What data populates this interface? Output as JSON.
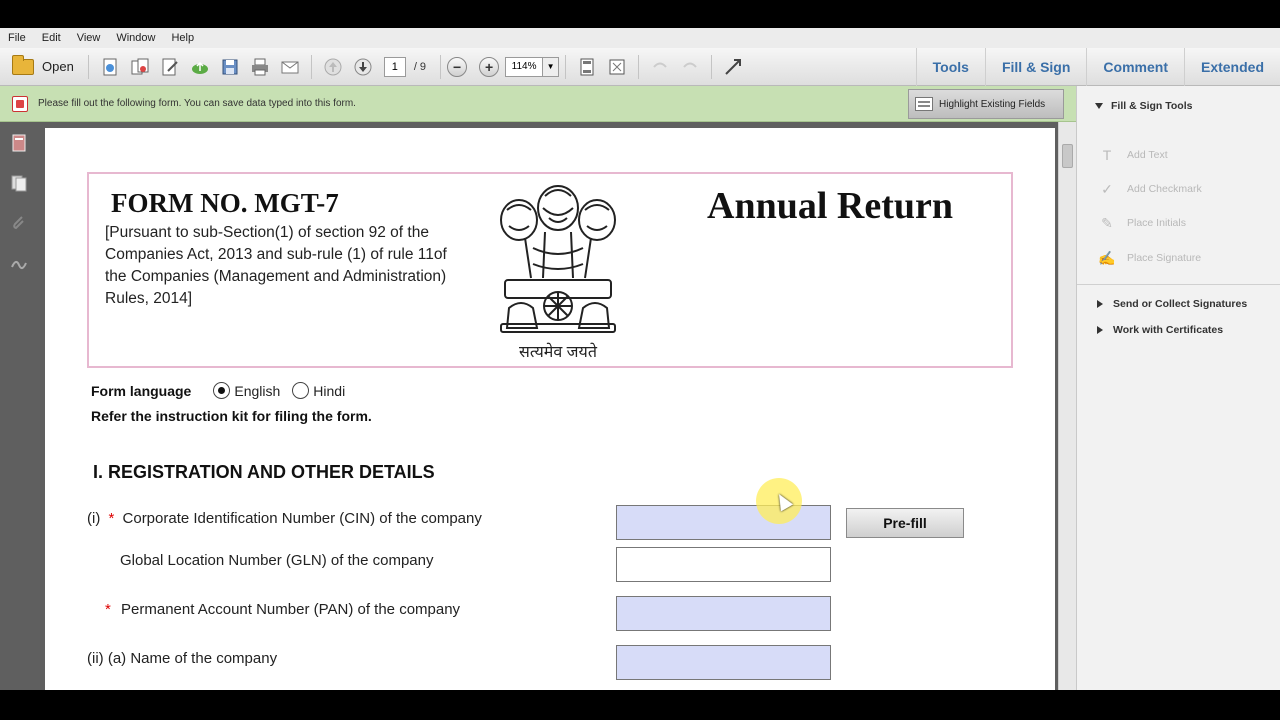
{
  "menu": [
    "File",
    "Edit",
    "View",
    "Window",
    "Help"
  ],
  "toolbar": {
    "open_label": "Open",
    "page_current": "1",
    "page_total": "/ 9",
    "zoom": "114%",
    "right_tabs": [
      "Tools",
      "Fill & Sign",
      "Comment",
      "Extended"
    ]
  },
  "docbar": {
    "message": "Please fill out the following form. You can save data typed into this form.",
    "highlight_label": "Highlight Existing Fields"
  },
  "form": {
    "form_no": "FORM NO. MGT-7",
    "subtitle": "[Pursuant to sub-Section(1) of section 92 of the Companies Act, 2013 and sub-rule (1) of rule 11of the Companies (Management and Administration) Rules, 2014]",
    "emblem_motto": "सत्यमेव जयते",
    "title": "Annual Return",
    "language_label": "Form language",
    "lang_options": [
      "English",
      "Hindi"
    ],
    "refer_text": "Refer the instruction kit for filing the form.",
    "section_title": "I. REGISTRATION AND OTHER DETAILS",
    "fields": {
      "cin_prefix": "(i)",
      "cin_label": "Corporate Identification Number (CIN) of the company",
      "gln_label": "Global Location Number (GLN) of the company",
      "pan_label": "Permanent Account Number (PAN) of the company",
      "name_label": "(ii)  (a) Name of the company"
    },
    "required_mark": "*",
    "prefill_label": "Pre-fill"
  },
  "right_panel": {
    "section": "Fill & Sign Tools",
    "tools": [
      "Add Text",
      "Add Checkmark",
      "Place Initials",
      "Place Signature"
    ],
    "links": [
      "Send or Collect Signatures",
      "Work with Certificates"
    ]
  },
  "colors": {
    "docbar_bg": "#c7e0b3",
    "required_field_bg": "#d7dcf8",
    "tab_blue": "#3a6fa8",
    "header_border": "#e7b8d0"
  }
}
